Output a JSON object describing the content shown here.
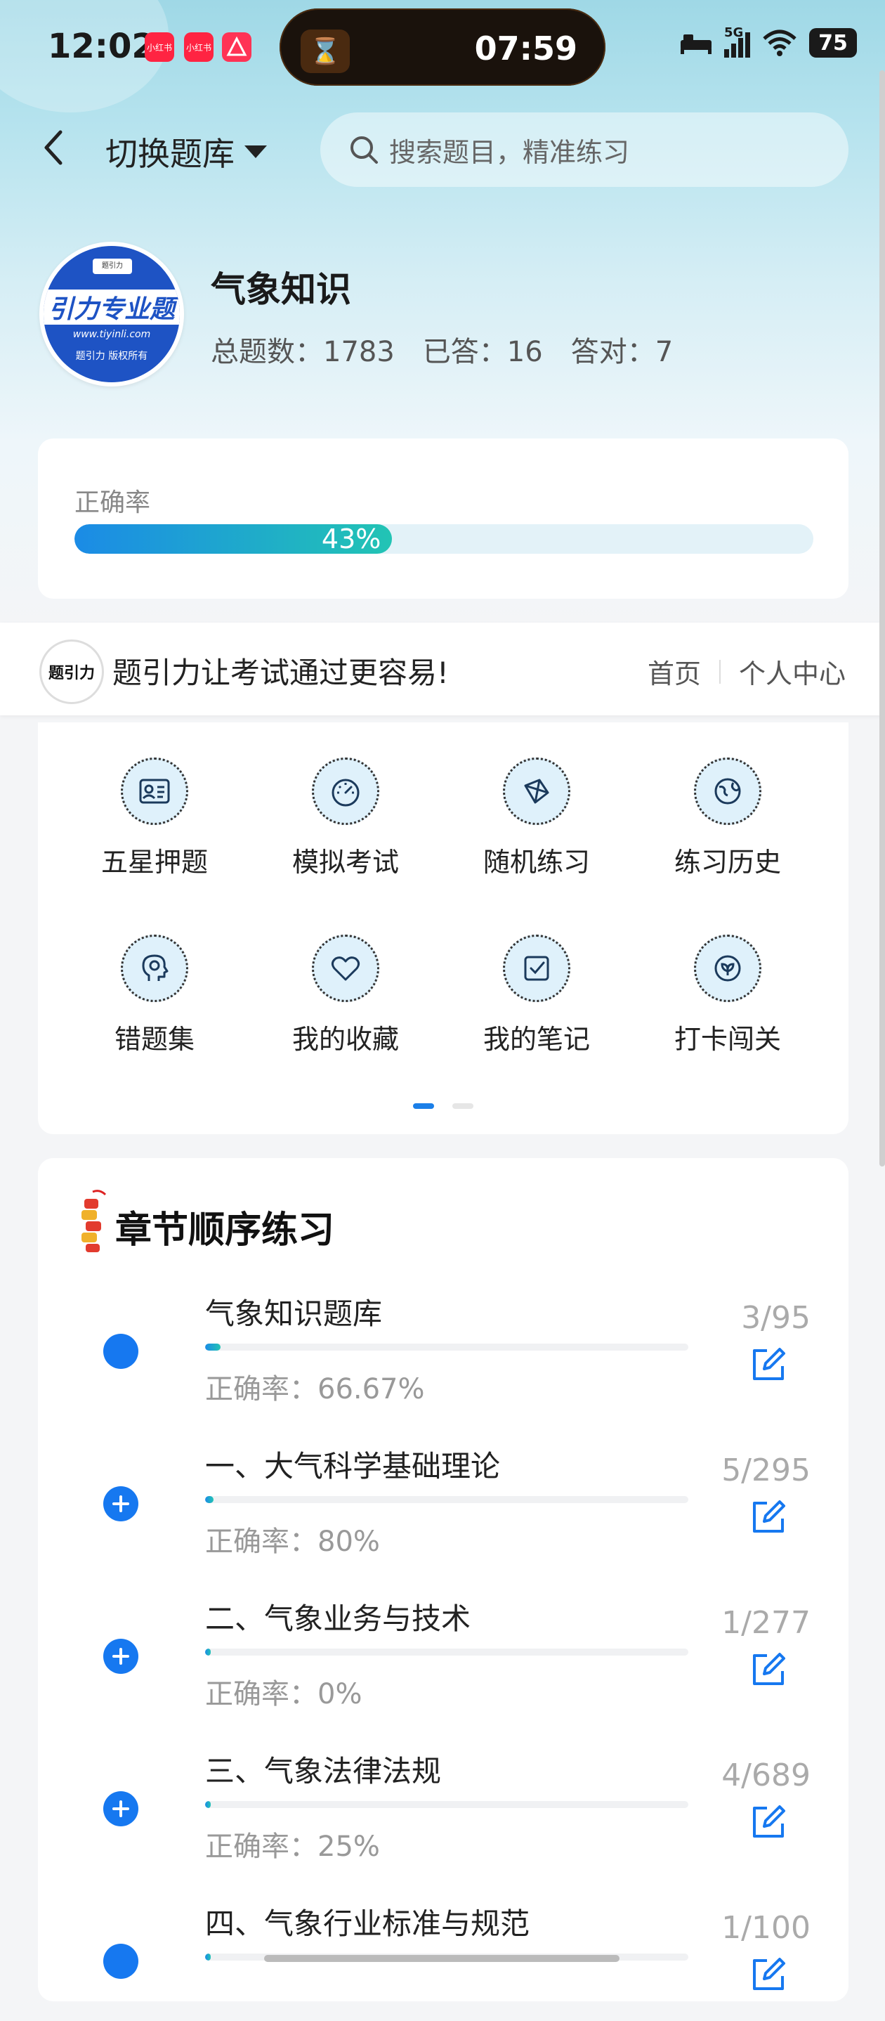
{
  "status_bar": {
    "time": "12:02",
    "app_badges": [
      {
        "name": "xiaohongshu-badge-1",
        "label": "小红书",
        "color": "#ff2442"
      },
      {
        "name": "xiaohongshu-badge-2",
        "label": "小红书",
        "color": "#ff2442"
      },
      {
        "name": "app-badge-3",
        "label": "",
        "color": "#ff3355"
      }
    ],
    "island_time": "07:59",
    "network": "5G",
    "battery": "75"
  },
  "nav": {
    "switch_label": "切换题库",
    "search_placeholder": "搜索题目，精准练习"
  },
  "bank": {
    "logo_band_text": "引力专业题",
    "logo_url": "www.tiyinli.com",
    "logo_copyright": "题引力 版权所有",
    "logo_mini": "题引力",
    "name": "气象知识",
    "total_label": "总题数：1783",
    "answered_label": "已答：16",
    "correct_label": "答对：7"
  },
  "accuracy": {
    "label": "正确率",
    "percent_text": "43%",
    "value": 0.43
  },
  "banner": {
    "logo_text": "题引力",
    "slogan": "题引力让考试通过更容易!",
    "link_home": "首页",
    "link_profile": "个人中心"
  },
  "features": [
    {
      "label": "五星押题",
      "icon": "id-card-icon"
    },
    {
      "label": "模拟考试",
      "icon": "gauge-icon"
    },
    {
      "label": "随机练习",
      "icon": "network-icon"
    },
    {
      "label": "练习历史",
      "icon": "globe-icon"
    },
    {
      "label": "错题集",
      "icon": "head-icon"
    },
    {
      "label": "我的收藏",
      "icon": "heart-icon"
    },
    {
      "label": "我的笔记",
      "icon": "checkbox-icon"
    },
    {
      "label": "打卡闯关",
      "icon": "leaf-icon"
    }
  ],
  "pager": {
    "pages": 2,
    "active": 0
  },
  "chapters": {
    "title": "章节顺序练习",
    "items": [
      {
        "name": "气象知识题库",
        "accuracy": "正确率：66.67%",
        "count": "3/95",
        "progress": 0.032,
        "marker": "dot",
        "marker_color": "#1678f0"
      },
      {
        "name": "一、大气科学基础理论",
        "accuracy": "正确率：80%",
        "count": "5/295",
        "progress": 0.017,
        "marker": "plus",
        "marker_color": "#1678f0"
      },
      {
        "name": "二、气象业务与技术",
        "accuracy": "正确率：0%",
        "count": "1/277",
        "progress": 0.004,
        "marker": "plus",
        "marker_color": "#1678f0"
      },
      {
        "name": "三、气象法律法规",
        "accuracy": "正确率：25%",
        "count": "4/689",
        "progress": 0.006,
        "marker": "plus",
        "marker_color": "#1678f0"
      },
      {
        "name": "四、气象行业标准与规范",
        "accuracy": "",
        "count": "1/100",
        "progress": 0.01,
        "marker": "dot",
        "marker_color": "#1678f0"
      }
    ]
  }
}
